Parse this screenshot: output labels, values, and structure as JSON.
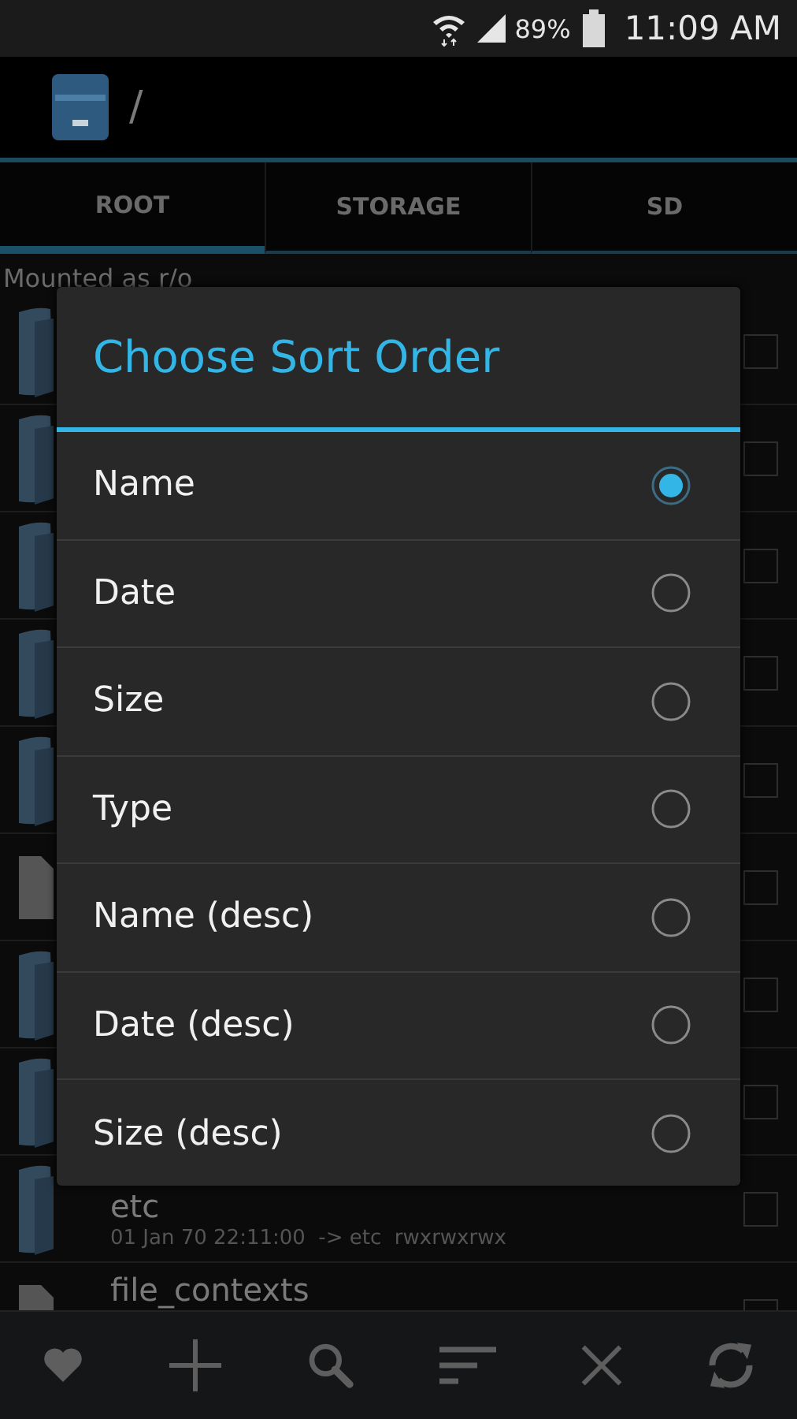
{
  "status_bar": {
    "battery": "89%",
    "time": "11:09 AM"
  },
  "app_bar": {
    "path": "/"
  },
  "tabs": [
    {
      "label": "ROOT",
      "selected": true
    },
    {
      "label": "STORAGE",
      "selected": false
    },
    {
      "label": "SD",
      "selected": false
    }
  ],
  "mount_status": "Mounted as r/o",
  "files": [
    {
      "kind": "folder",
      "checked": false
    },
    {
      "kind": "folder",
      "checked": false
    },
    {
      "kind": "folder",
      "checked": false
    },
    {
      "kind": "folder",
      "checked": false
    },
    {
      "kind": "folder",
      "checked": false
    },
    {
      "kind": "file",
      "checked": false
    },
    {
      "kind": "folder",
      "checked": false
    },
    {
      "kind": "folder",
      "checked": false
    },
    {
      "kind": "folder",
      "name": "etc",
      "details": "01 Jan 70 22:11:00  -> etc  rwxrwxrwx",
      "checked": false
    },
    {
      "kind": "file",
      "name": "file_contexts",
      "checked": false
    }
  ],
  "dialog": {
    "title": "Choose Sort Order",
    "options": [
      {
        "label": "Name",
        "selected": true
      },
      {
        "label": "Date",
        "selected": false
      },
      {
        "label": "Size",
        "selected": false
      },
      {
        "label": "Type",
        "selected": false
      },
      {
        "label": "Name (desc)",
        "selected": false
      },
      {
        "label": "Date (desc)",
        "selected": false
      },
      {
        "label": "Size (desc)",
        "selected": false
      }
    ]
  }
}
